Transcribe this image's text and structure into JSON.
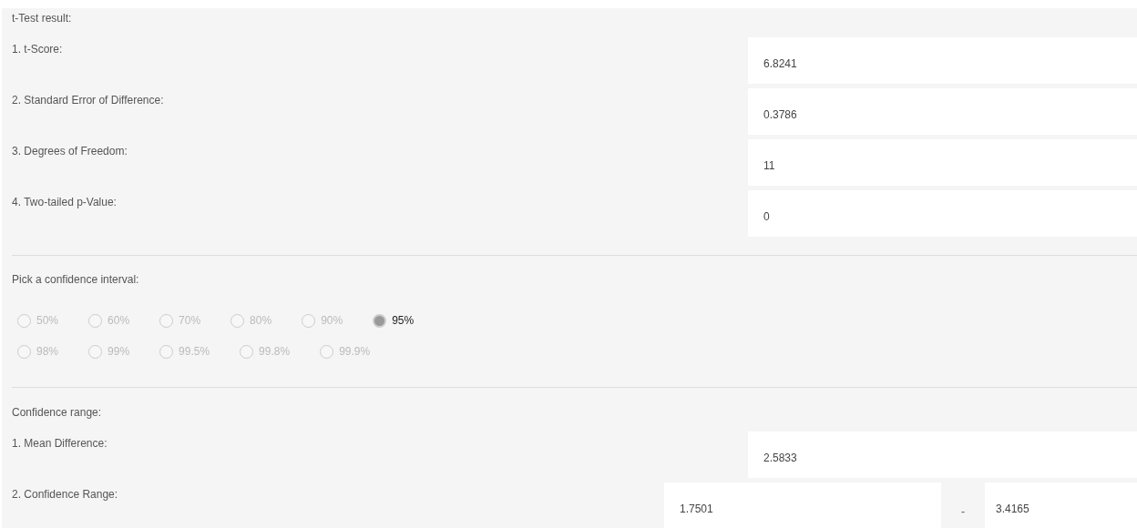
{
  "results": {
    "title": "t-Test result:",
    "items": [
      {
        "label": "1. t-Score:",
        "value": "6.8241"
      },
      {
        "label": "2. Standard Error of Difference:",
        "value": "0.3786"
      },
      {
        "label": "3. Degrees of Freedom:",
        "value": "11"
      },
      {
        "label": "4. Two-tailed p-Value:",
        "value": "0"
      }
    ]
  },
  "confidence": {
    "title": "Pick a confidence interval:",
    "rows": [
      [
        {
          "label": "50%",
          "selected": false
        },
        {
          "label": "60%",
          "selected": false
        },
        {
          "label": "70%",
          "selected": false
        },
        {
          "label": "80%",
          "selected": false
        },
        {
          "label": "90%",
          "selected": false
        },
        {
          "label": "95%",
          "selected": true
        }
      ],
      [
        {
          "label": "98%",
          "selected": false
        },
        {
          "label": "99%",
          "selected": false
        },
        {
          "label": "99.5%",
          "selected": false
        },
        {
          "label": "99.8%",
          "selected": false
        },
        {
          "label": "99.9%",
          "selected": false
        }
      ]
    ]
  },
  "range": {
    "title": "Confidence range:",
    "mean": {
      "label": "1. Mean Difference:",
      "value": "2.5833"
    },
    "interval": {
      "label": "2. Confidence Range:",
      "lower": "1.7501",
      "separator": "-",
      "upper": "3.4165"
    }
  }
}
